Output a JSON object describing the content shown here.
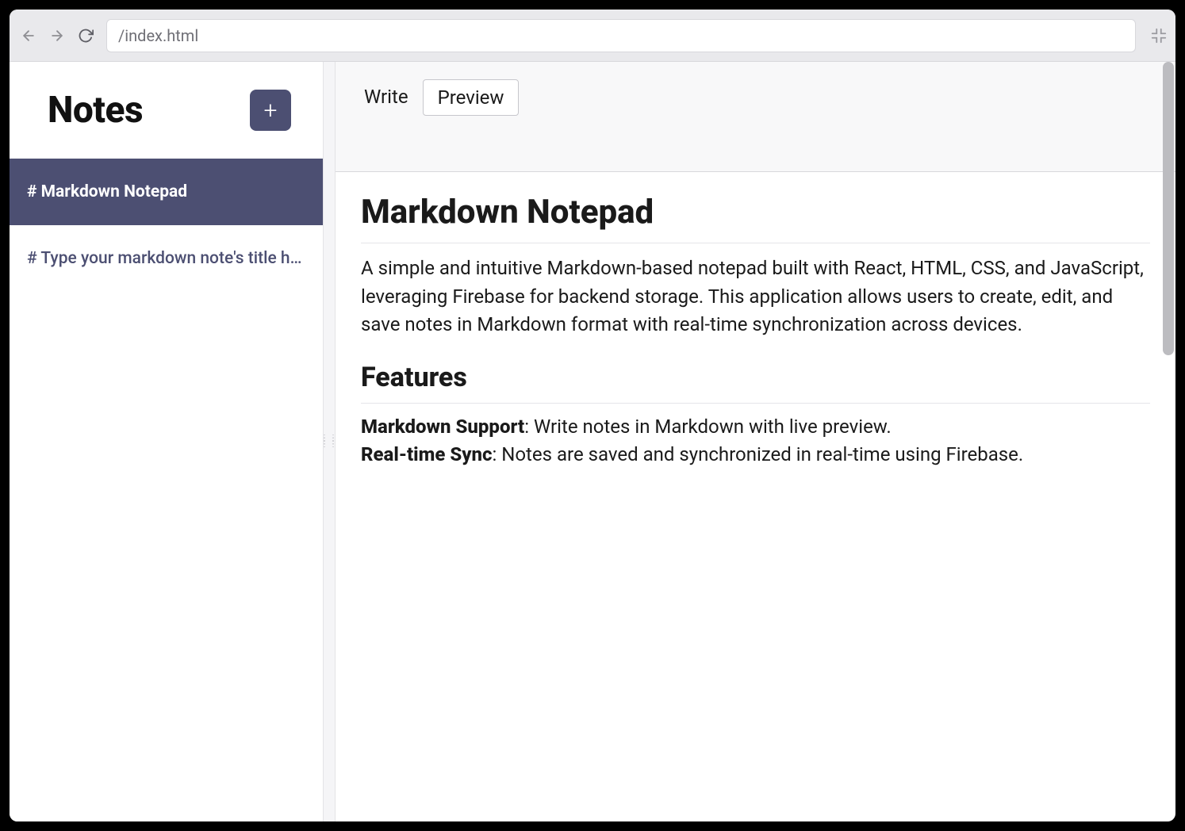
{
  "browser": {
    "url": "/index.html"
  },
  "sidebar": {
    "title": "Notes",
    "add_label": "+",
    "items": [
      {
        "label": "# Markdown Notepad",
        "active": true
      },
      {
        "label": "# Type your markdown note's title here",
        "active": false
      }
    ]
  },
  "tabs": {
    "write": "Write",
    "preview": "Preview",
    "selected": "preview"
  },
  "preview": {
    "h1": "Markdown Notepad",
    "intro": "A simple and intuitive Markdown-based notepad built with React, HTML, CSS, and JavaScript, leveraging Firebase for backend storage. This application allows users to create, edit, and save notes in Markdown format with real-time synchronization across devices.",
    "h2": "Features",
    "feature1_bold": "Markdown Support",
    "feature1_rest": ": Write notes in Markdown with live preview.",
    "feature2_bold": "Real-time Sync",
    "feature2_rest": ": Notes are saved and synchronized in real-time using Firebase."
  },
  "colors": {
    "accent": "#4c4f72"
  }
}
